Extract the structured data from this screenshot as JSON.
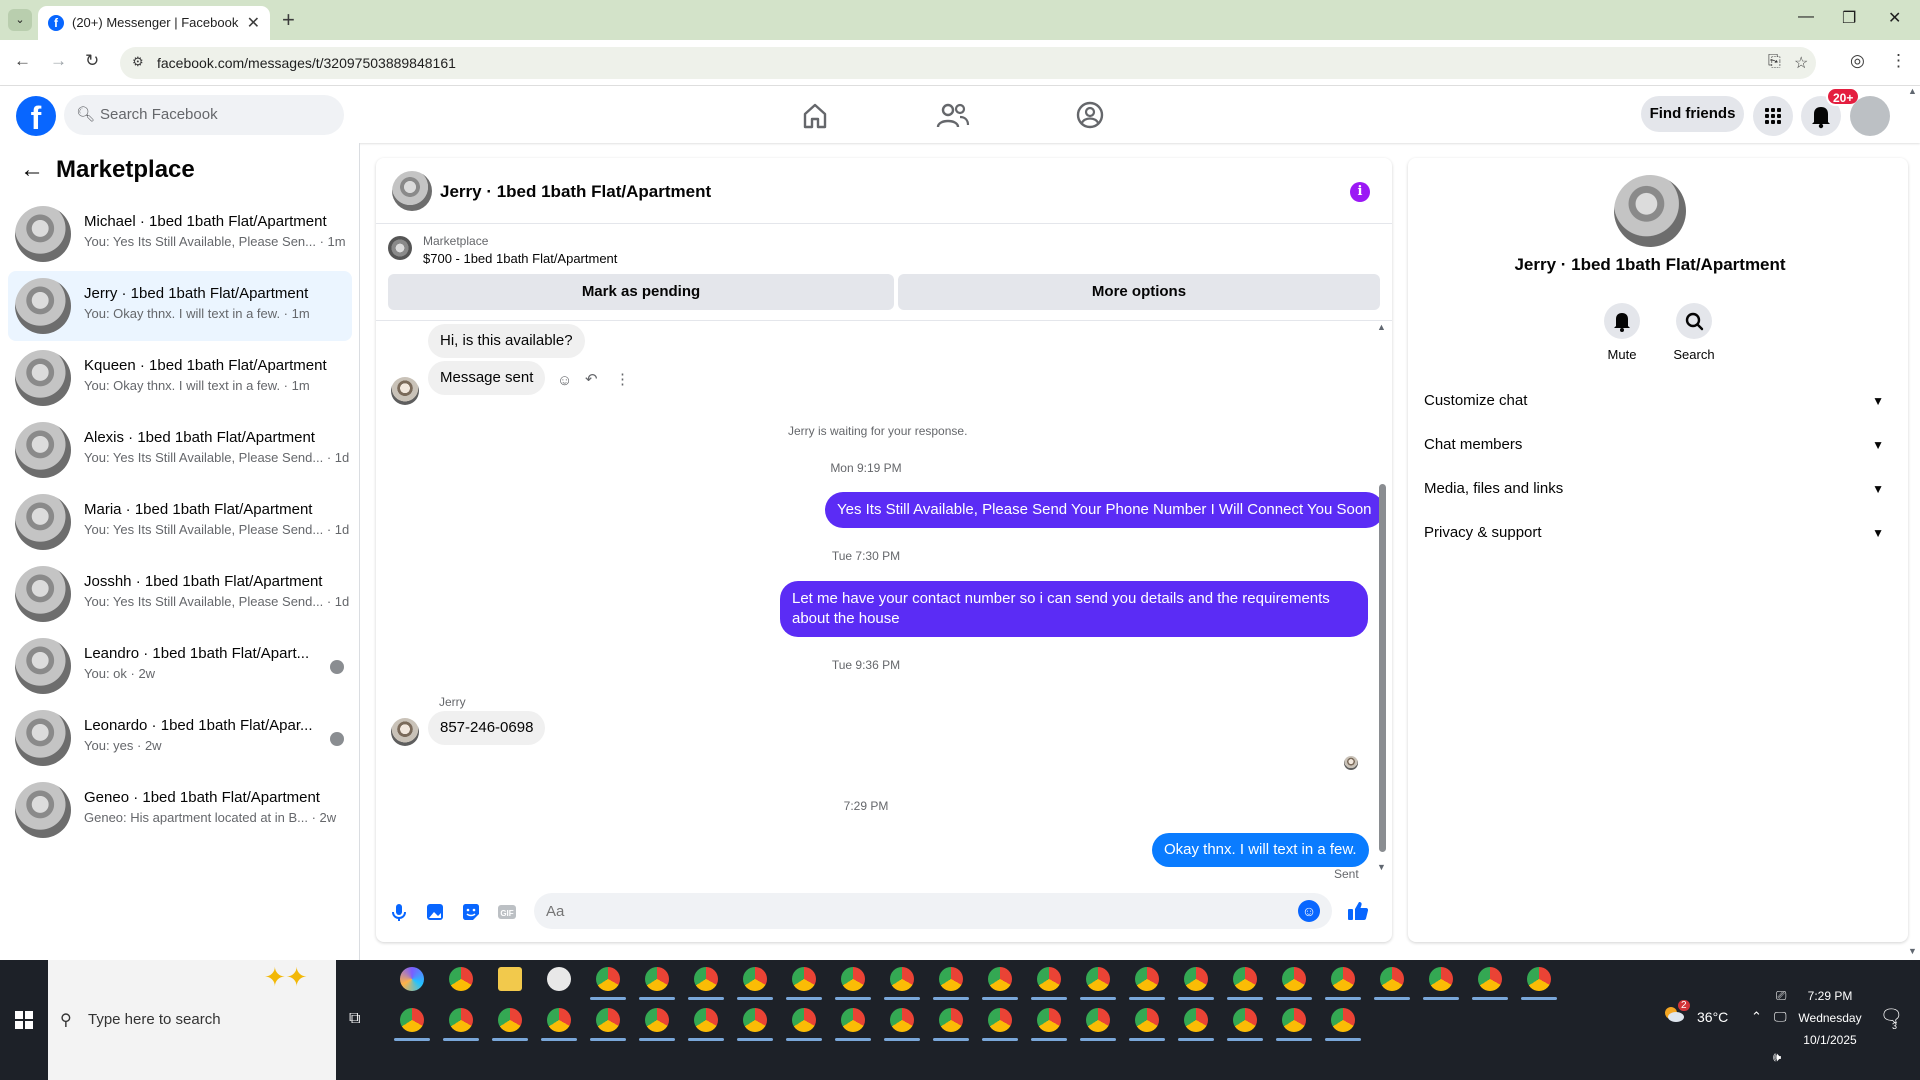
{
  "browser": {
    "tab_title": "(20+) Messenger | Facebook",
    "url": "facebook.com/messages/t/32097503889848161"
  },
  "header": {
    "search_placeholder": "Search Facebook",
    "find_friends": "Find friends",
    "notification_badge": "20+"
  },
  "sidebar": {
    "title": "Marketplace",
    "conversations": [
      {
        "name": "Michael · 1bed 1bath Flat/Apartment",
        "preview": "You: Yes Its Still Available, Please Sen... · 1m",
        "active": false
      },
      {
        "name": "Jerry · 1bed 1bath Flat/Apartment",
        "preview": "You: Okay thnx. I will text in a few. · 1m",
        "active": true
      },
      {
        "name": "Kqueen · 1bed 1bath Flat/Apartment",
        "preview": "You: Okay thnx. I will text in a few. · 1m",
        "active": false
      },
      {
        "name": "Alexis · 1bed 1bath Flat/Apartment",
        "preview": "You: Yes Its Still Available, Please Send... · 1d",
        "active": false
      },
      {
        "name": "Maria · 1bed 1bath Flat/Apartment",
        "preview": "You: Yes Its Still Available, Please Send... · 1d",
        "active": false
      },
      {
        "name": "Josshh · 1bed 1bath Flat/Apartment",
        "preview": "You: Yes Its Still Available, Please Send... · 1d",
        "active": false
      },
      {
        "name": "Leandro · 1bed 1bath Flat/Apart...",
        "preview": "You: ok · 2w",
        "active": false
      },
      {
        "name": "Leonardo · 1bed 1bath Flat/Apar...",
        "preview": "You: yes · 2w",
        "active": false
      },
      {
        "name": "Geneo · 1bed 1bath Flat/Apartment",
        "preview": "Geneo: His apartment located at in B... · 2w",
        "active": false
      }
    ]
  },
  "chat": {
    "title": "Jerry · 1bed 1bath Flat/Apartment",
    "listing_label": "Marketplace",
    "listing_price": "$700 - 1bed 1bath Flat/Apartment",
    "mark_pending": "Mark as pending",
    "more_options": "More options",
    "messages": {
      "in1": "Hi, is this available?",
      "in2": "Message sent",
      "waiting": "Jerry is waiting for your response.",
      "ts1": "Mon 9:19 PM",
      "out1": "Yes Its Still Available, Please Send Your Phone Number I Will Connect You Soon",
      "ts2": "Tue 7:30 PM",
      "out2": "Let me have your contact number so i can send you details and the requirements about the house",
      "ts3": "Tue 9:36 PM",
      "sender": "Jerry",
      "in3": "857-246-0698",
      "ts4": "7:29 PM",
      "out3": "Okay thnx. I will text in a few.",
      "status": "Sent"
    },
    "composer_placeholder": "Aa"
  },
  "info_panel": {
    "name": "Jerry · 1bed 1bath Flat/Apartment",
    "mute": "Mute",
    "search": "Search",
    "sections": [
      "Customize chat",
      "Chat members",
      "Media, files and links",
      "Privacy & support"
    ]
  },
  "taskbar": {
    "search_placeholder": "Type here to search",
    "weather": "36°C",
    "weather_badge": "2",
    "time": "7:29 PM",
    "day": "Wednesday",
    "date": "10/1/2025",
    "notif_count": "3"
  },
  "colors": {
    "fb_blue": "#0866ff",
    "outgoing_purple": "#5b2cf5",
    "outgoing_blue": "#0a7cff",
    "info_purple": "#9b18f5"
  }
}
